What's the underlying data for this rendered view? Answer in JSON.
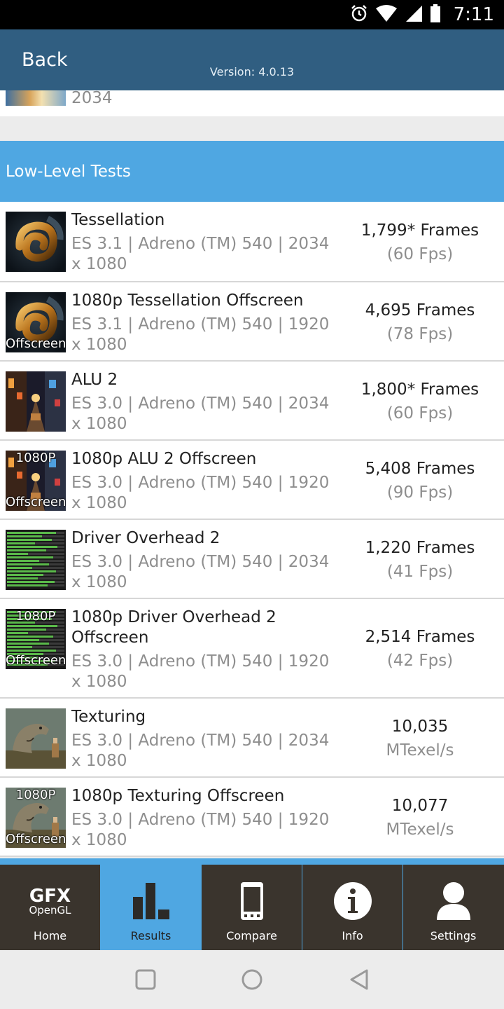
{
  "status_bar": {
    "time": "7:11"
  },
  "header": {
    "back_label": "Back",
    "version": "Version: 4.0.13"
  },
  "previous_row": {
    "text": "2034"
  },
  "section": {
    "title": "Low-Level Tests"
  },
  "tests": [
    {
      "name": "Tessellation",
      "sub": "ES 3.1 | Adreno (TM) 540 | 2034 x 1080",
      "result": "1,799* Frames",
      "result_sub": "(60 Fps)",
      "thumb": "tessellation",
      "badge_top": "",
      "badge_bottom": ""
    },
    {
      "name": "1080p Tessellation Offscreen",
      "sub": "ES 3.1 | Adreno (TM) 540 | 1920 x 1080",
      "result": "4,695 Frames",
      "result_sub": "(78 Fps)",
      "thumb": "tessellation",
      "badge_top": "",
      "badge_bottom": "Offscreen"
    },
    {
      "name": "ALU 2",
      "sub": "ES 3.0 | Adreno (TM) 540 | 2034 x 1080",
      "result": "1,800* Frames",
      "result_sub": "(60 Fps)",
      "thumb": "alu",
      "badge_top": "",
      "badge_bottom": ""
    },
    {
      "name": "1080p ALU 2 Offscreen",
      "sub": "ES 3.0 | Adreno (TM) 540 | 1920 x 1080",
      "result": "5,408 Frames",
      "result_sub": "(90 Fps)",
      "thumb": "alu",
      "badge_top": "1080P",
      "badge_bottom": "Offscreen"
    },
    {
      "name": "Driver Overhead 2",
      "sub": "ES 3.0 | Adreno (TM) 540 | 2034 x 1080",
      "result": "1,220 Frames",
      "result_sub": "(41 Fps)",
      "thumb": "driver",
      "badge_top": "",
      "badge_bottom": ""
    },
    {
      "name": "1080p Driver Overhead 2 Offscreen",
      "sub": "ES 3.0 | Adreno (TM) 540 | 1920 x 1080",
      "result": "2,514 Frames",
      "result_sub": "(42 Fps)",
      "thumb": "driver",
      "badge_top": "1080P",
      "badge_bottom": "Offscreen"
    },
    {
      "name": "Texturing",
      "sub": "ES 3.0 | Adreno (TM) 540 | 2034 x 1080",
      "result": "10,035",
      "result_sub": "MTexel/s",
      "thumb": "texturing",
      "badge_top": "",
      "badge_bottom": ""
    },
    {
      "name": "1080p Texturing Offscreen",
      "sub": "ES 3.0 | Adreno (TM) 540 | 1920 x 1080",
      "result": "10,077",
      "result_sub": "MTexel/s",
      "thumb": "texturing",
      "badge_top": "1080P",
      "badge_bottom": "Offscreen"
    }
  ],
  "tabs": [
    {
      "label": "Home",
      "icon": "gfx-logo",
      "logo_top": "GFX",
      "logo_bottom": "OpenGL"
    },
    {
      "label": "Results",
      "icon": "bar-chart-icon",
      "active": true
    },
    {
      "label": "Compare",
      "icon": "phone-icon"
    },
    {
      "label": "Info",
      "icon": "info-icon"
    },
    {
      "label": "Settings",
      "icon": "user-icon"
    }
  ],
  "colors": {
    "header": "#305e81",
    "accent": "#4fa7e2",
    "tab_bg": "#3a342d"
  }
}
